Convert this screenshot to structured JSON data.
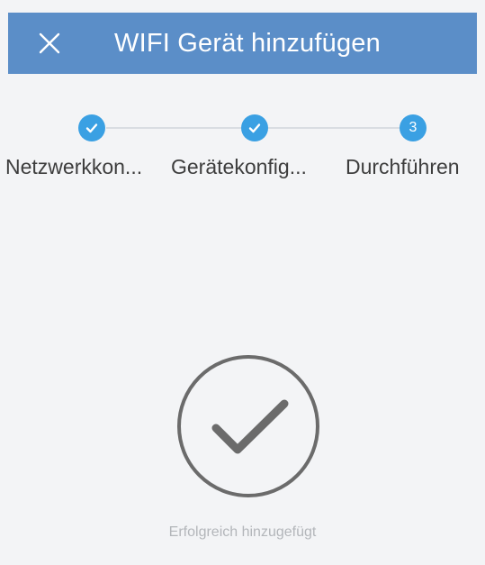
{
  "header": {
    "title": "WIFI Gerät hinzufügen",
    "close_icon": "close-icon",
    "background_color": "#5b8ec8"
  },
  "stepper": {
    "accent_color": "#3aa0e3",
    "steps": [
      {
        "label": "Netzwerkkon...",
        "state": "completed",
        "icon": "check-icon"
      },
      {
        "label": "Gerätekonfig...",
        "state": "completed",
        "icon": "check-icon"
      },
      {
        "label": "Durchführen",
        "state": "current",
        "number": "3"
      }
    ]
  },
  "result": {
    "icon": "success-check-icon",
    "message": "Erfolgreich hinzugefügt"
  }
}
